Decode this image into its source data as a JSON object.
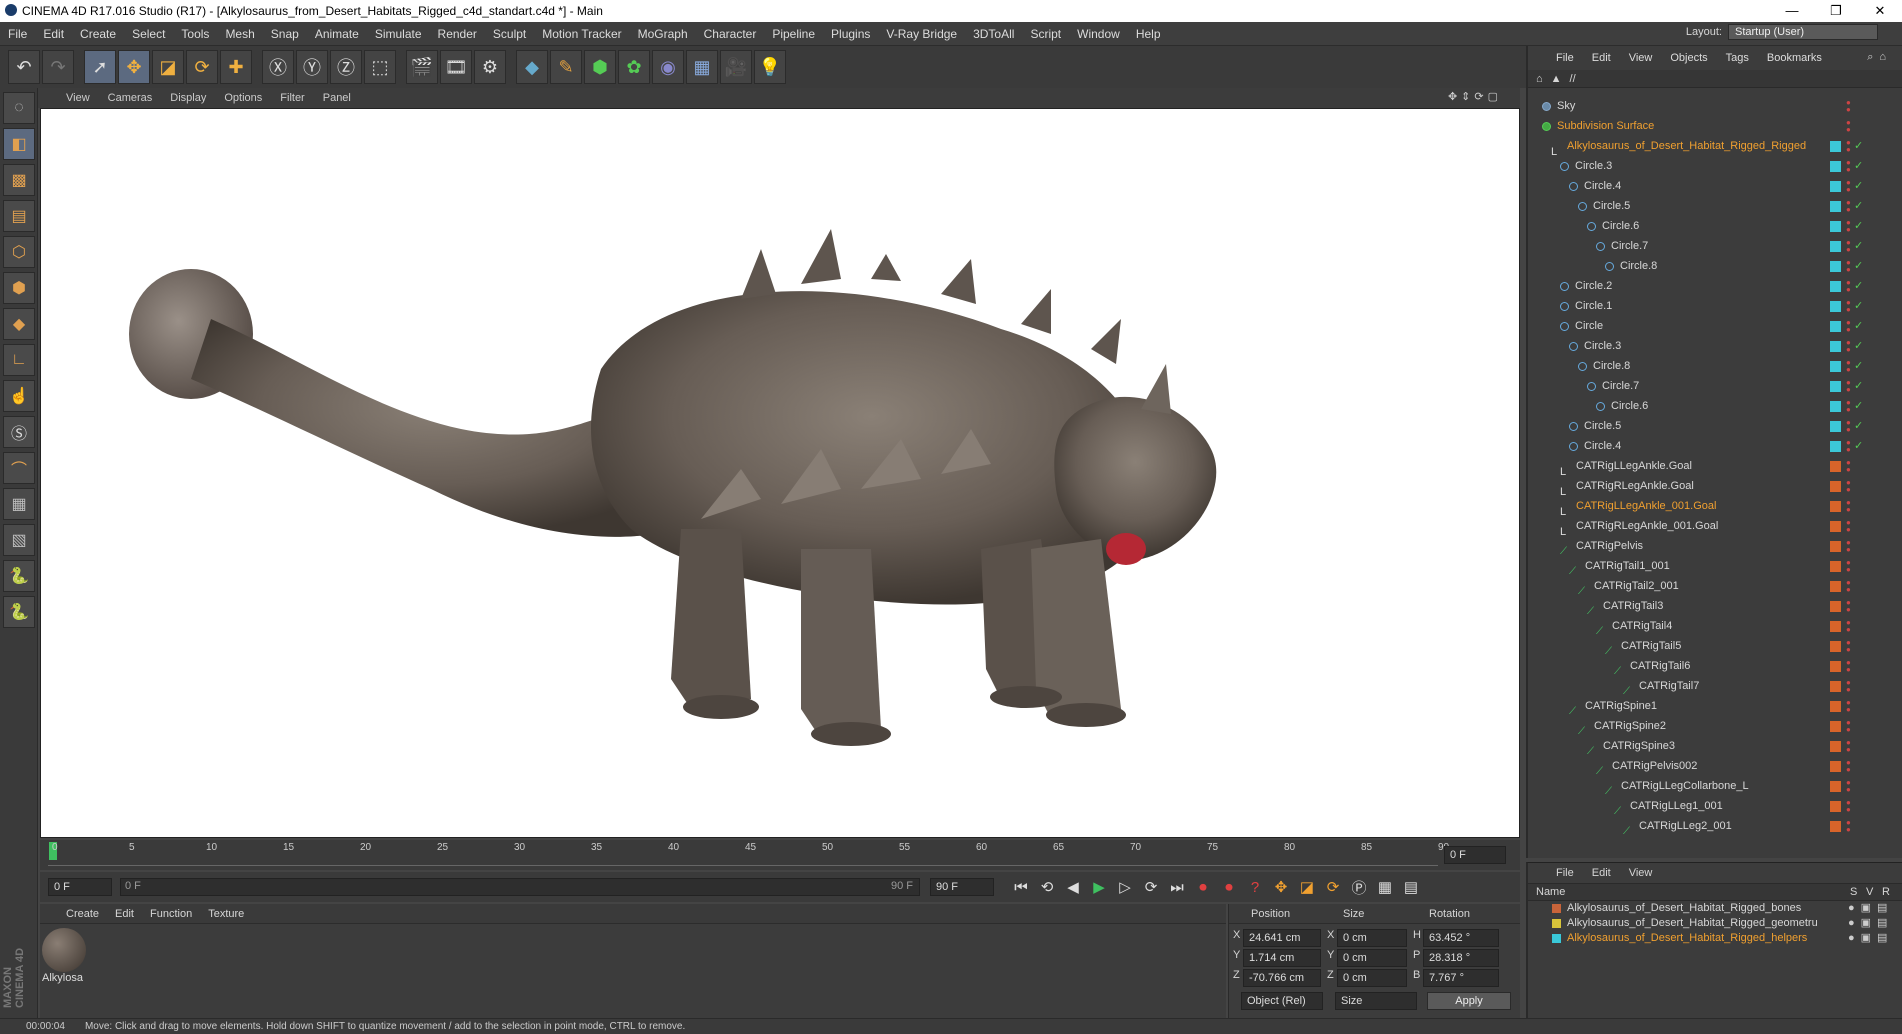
{
  "app": {
    "window_title": "CINEMA 4D R17.016 Studio (R17) - [Alkylosaurus_from_Desert_Habitats_Rigged_c4d_standart.c4d *] - Main",
    "minimize": "—",
    "restore": "❐",
    "close": "✕",
    "layout_label": "Layout:",
    "layout_value": "Startup (User)"
  },
  "menus": [
    "File",
    "Edit",
    "Create",
    "Select",
    "Tools",
    "Mesh",
    "Snap",
    "Animate",
    "Simulate",
    "Render",
    "Sculpt",
    "Motion Tracker",
    "MoGraph",
    "Character",
    "Pipeline",
    "Plugins",
    "V-Ray Bridge",
    "3DToAll",
    "Script",
    "Window",
    "Help"
  ],
  "viewport": {
    "menus": [
      "View",
      "Cameras",
      "Display",
      "Options",
      "Filter",
      "Panel"
    ]
  },
  "timeline": {
    "ticks": [
      "0",
      "5",
      "10",
      "15",
      "20",
      "25",
      "30",
      "35",
      "40",
      "45",
      "50",
      "55",
      "60",
      "65",
      "70",
      "75",
      "80",
      "85",
      "90"
    ],
    "frame_field": "0 F"
  },
  "transport": {
    "start": "0 F",
    "current": "0 F",
    "range_end_in": "90 F",
    "end": "90 F"
  },
  "materials": {
    "menus": [
      "Create",
      "Edit",
      "Function",
      "Texture"
    ],
    "items": [
      {
        "name": "Alkylosa"
      }
    ]
  },
  "coords": {
    "headers": {
      "position": "Position",
      "size": "Size",
      "rotation": "Rotation"
    },
    "rows": [
      {
        "axis": "X",
        "pos": "24.641 cm",
        "saxis": "X",
        "size": "0 cm",
        "raxis": "H",
        "rot": "63.452 °"
      },
      {
        "axis": "Y",
        "pos": "1.714 cm",
        "saxis": "Y",
        "size": "0 cm",
        "raxis": "P",
        "rot": "28.318 °"
      },
      {
        "axis": "Z",
        "pos": "-70.766 cm",
        "saxis": "Z",
        "size": "0 cm",
        "raxis": "B",
        "rot": "7.767 °"
      }
    ],
    "mode": "Object (Rel)",
    "size_mode": "Size",
    "apply": "Apply"
  },
  "status": {
    "time": "00:00:04",
    "message": "Move: Click and drag to move elements. Hold down SHIFT to quantize movement / add to the selection in point mode, CTRL to remove."
  },
  "object_manager": {
    "menus": [
      "File",
      "Edit",
      "View",
      "Objects",
      "Tags",
      "Bookmarks"
    ],
    "path": "//",
    "objects": [
      {
        "name": "Sky",
        "depth": 0,
        "icon": "sky",
        "tag": "none"
      },
      {
        "name": "Subdivision Surface",
        "depth": 0,
        "icon": "subdiv",
        "tag": "none",
        "hl": true
      },
      {
        "name": "Alkylosaurus_of_Desert_Habitat_Rigged_Rigged",
        "depth": 1,
        "icon": "null",
        "tag": "cyan",
        "hl": true
      },
      {
        "name": "Circle.3",
        "depth": 2,
        "icon": "circle",
        "tag": "cyan"
      },
      {
        "name": "Circle.4",
        "depth": 3,
        "icon": "circle",
        "tag": "cyan"
      },
      {
        "name": "Circle.5",
        "depth": 4,
        "icon": "circle",
        "tag": "cyan"
      },
      {
        "name": "Circle.6",
        "depth": 5,
        "icon": "circle",
        "tag": "cyan"
      },
      {
        "name": "Circle.7",
        "depth": 6,
        "icon": "circle",
        "tag": "cyan"
      },
      {
        "name": "Circle.8",
        "depth": 7,
        "icon": "circle",
        "tag": "cyan"
      },
      {
        "name": "Circle.2",
        "depth": 2,
        "icon": "circle",
        "tag": "cyan"
      },
      {
        "name": "Circle.1",
        "depth": 2,
        "icon": "circle",
        "tag": "cyan"
      },
      {
        "name": "Circle",
        "depth": 2,
        "icon": "circle",
        "tag": "cyan"
      },
      {
        "name": "Circle.3",
        "depth": 3,
        "icon": "circle",
        "tag": "cyan"
      },
      {
        "name": "Circle.8",
        "depth": 4,
        "icon": "circle",
        "tag": "cyan"
      },
      {
        "name": "Circle.7",
        "depth": 5,
        "icon": "circle",
        "tag": "cyan"
      },
      {
        "name": "Circle.6",
        "depth": 6,
        "icon": "circle",
        "tag": "cyan"
      },
      {
        "name": "Circle.5",
        "depth": 3,
        "icon": "circle",
        "tag": "cyan"
      },
      {
        "name": "Circle.4",
        "depth": 3,
        "icon": "circle",
        "tag": "cyan"
      },
      {
        "name": "CATRigLLegAnkle.Goal",
        "depth": 2,
        "icon": "null",
        "tag": "orange"
      },
      {
        "name": "CATRigRLegAnkle.Goal",
        "depth": 2,
        "icon": "null",
        "tag": "orange"
      },
      {
        "name": "CATRigLLegAnkle_001.Goal",
        "depth": 2,
        "icon": "null",
        "tag": "orange",
        "hl": true
      },
      {
        "name": "CATRigRLegAnkle_001.Goal",
        "depth": 2,
        "icon": "null",
        "tag": "orange"
      },
      {
        "name": "CATRigPelvis",
        "depth": 2,
        "icon": "bone",
        "tag": "orange"
      },
      {
        "name": "CATRigTail1_001",
        "depth": 3,
        "icon": "bone",
        "tag": "orange"
      },
      {
        "name": "CATRigTail2_001",
        "depth": 4,
        "icon": "bone",
        "tag": "orange"
      },
      {
        "name": "CATRigTail3",
        "depth": 5,
        "icon": "bone",
        "tag": "orange"
      },
      {
        "name": "CATRigTail4",
        "depth": 6,
        "icon": "bone",
        "tag": "orange"
      },
      {
        "name": "CATRigTail5",
        "depth": 7,
        "icon": "bone",
        "tag": "orange"
      },
      {
        "name": "CATRigTail6",
        "depth": 8,
        "icon": "bone",
        "tag": "orange"
      },
      {
        "name": "CATRigTail7",
        "depth": 9,
        "icon": "bone",
        "tag": "orange"
      },
      {
        "name": "CATRigSpine1",
        "depth": 3,
        "icon": "bone",
        "tag": "orange"
      },
      {
        "name": "CATRigSpine2",
        "depth": 4,
        "icon": "bone",
        "tag": "orange"
      },
      {
        "name": "CATRigSpine3",
        "depth": 5,
        "icon": "bone",
        "tag": "orange"
      },
      {
        "name": "CATRigPelvis002",
        "depth": 6,
        "icon": "bone",
        "tag": "orange"
      },
      {
        "name": "CATRigLLegCollarbone_L",
        "depth": 7,
        "icon": "bone",
        "tag": "orange"
      },
      {
        "name": "CATRigLLeg1_001",
        "depth": 8,
        "icon": "bone",
        "tag": "orange"
      },
      {
        "name": "CATRigLLeg2_001",
        "depth": 9,
        "icon": "bone",
        "tag": "orange"
      }
    ]
  },
  "layer_manager": {
    "menus": [
      "File",
      "Edit",
      "View"
    ],
    "headers": {
      "name": "Name",
      "s": "S",
      "v": "V",
      "r": "R"
    },
    "layers": [
      {
        "name": "Alkylosaurus_of_Desert_Habitat_Rigged_bones",
        "color": "#c8643a"
      },
      {
        "name": "Alkylosaurus_of_Desert_Habitat_Rigged_geometru",
        "color": "#d8c43a"
      },
      {
        "name": "Alkylosaurus_of_Desert_Habitat_Rigged_helpers",
        "color": "#3ac8d8",
        "hl": true
      }
    ]
  },
  "colors": {
    "accent": "#f0a030",
    "tag_cyan": "#3cc8d8",
    "tag_orange": "#d8642a"
  }
}
